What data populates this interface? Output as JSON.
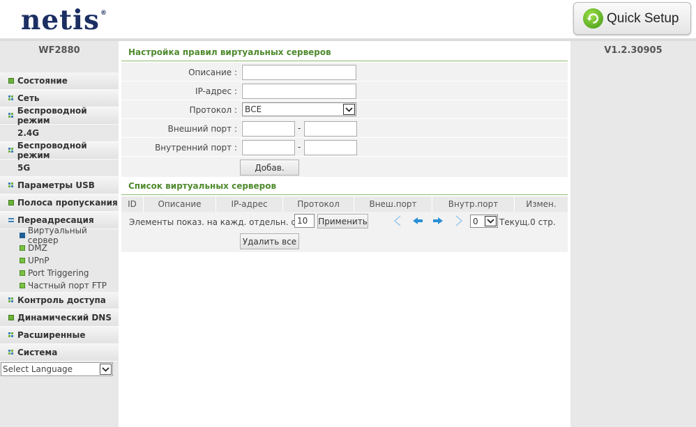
{
  "header": {
    "logo": "netis",
    "logo_mark": "®",
    "quick_setup_label": "Quick Setup"
  },
  "sidebar": {
    "model": "WF2880",
    "items": [
      {
        "label": "Состояние"
      },
      {
        "label": "Сеть"
      },
      {
        "label": "Беспроводной режим"
      },
      {
        "label": "2.4G"
      },
      {
        "label": "Беспроводной режим"
      },
      {
        "label": "5G"
      },
      {
        "label": "Параметры USB"
      },
      {
        "label": "Полоса пропускания"
      },
      {
        "label": "Переадресация"
      }
    ],
    "sub_items": [
      {
        "label": "Виртуальный сервер"
      },
      {
        "label": "DMZ"
      },
      {
        "label": "UPnP"
      },
      {
        "label": "Port Triggering"
      },
      {
        "label": "Частный порт FTP"
      }
    ],
    "items_after": [
      {
        "label": "Контроль доступа"
      },
      {
        "label": "Динамический DNS"
      },
      {
        "label": "Расширенные"
      },
      {
        "label": "Система"
      }
    ],
    "language_select": "Select Language"
  },
  "form": {
    "title": "Настройка правил виртуальных серверов",
    "description_label": "Описание :",
    "description_value": "",
    "ip_label": "IP-адрес :",
    "ip_value": "",
    "protocol_label": "Протокол :",
    "protocol_value": "ВСЕ",
    "ext_port_label": "Внешний порт :",
    "ext_port_from": "",
    "ext_port_to": "",
    "int_port_label": "Внутренний порт :",
    "int_port_from": "",
    "int_port_to": "",
    "dash": "-",
    "add_button": "Добав."
  },
  "list": {
    "title": "Список виртуальных серверов",
    "columns": [
      "ID",
      "Описание",
      "IP-адрес",
      "Протокол",
      "Внеш.порт",
      "Внутр.порт",
      "Измен."
    ],
    "per_page_label": "Элементы показ. на кажд. отдельн. стр.",
    "per_page_value": "10",
    "apply_button": "Применить",
    "page_value": "0",
    "current_page_label": "Текущ.0 стр.",
    "delete_all_button": "Удалить все"
  },
  "right": {
    "version": "V1.2.30905"
  },
  "colors": {
    "logo": "#1c2f63",
    "section_title": "#4f8a2e",
    "pager_arrows": "#2a8fd6"
  }
}
